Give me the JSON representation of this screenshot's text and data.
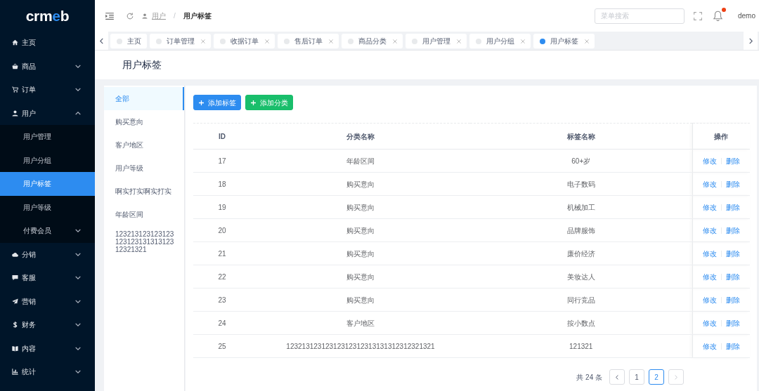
{
  "sidebar": {
    "logo": [
      {
        "text": "crm",
        "color": "#ffffff"
      },
      {
        "text": "e",
        "color": "#2d8cf0"
      },
      {
        "text": "b",
        "color": "#ffffff"
      }
    ],
    "items": [
      {
        "label": "主页",
        "kind": "link",
        "selected": false
      },
      {
        "label": "商品",
        "kind": "group",
        "selected": false,
        "expanded": false
      },
      {
        "label": "订单",
        "kind": "group",
        "selected": false,
        "expanded": false
      },
      {
        "label": "用户",
        "kind": "group",
        "selected": false,
        "expanded": true,
        "children": [
          {
            "label": "用户管理",
            "kind": "link",
            "selected": false
          },
          {
            "label": "用户分组",
            "kind": "link",
            "selected": false
          },
          {
            "label": "用户标签",
            "kind": "link",
            "selected": true
          },
          {
            "label": "用户等级",
            "kind": "link",
            "selected": false
          },
          {
            "label": "付费会员",
            "kind": "group",
            "selected": false,
            "expanded": false
          }
        ]
      },
      {
        "label": "分销",
        "kind": "group",
        "selected": false,
        "expanded": false
      },
      {
        "label": "客服",
        "kind": "group",
        "selected": false,
        "expanded": false
      },
      {
        "label": "营销",
        "kind": "group",
        "selected": false,
        "expanded": false
      },
      {
        "label": "财务",
        "kind": "group",
        "selected": false,
        "expanded": false
      },
      {
        "label": "内容",
        "kind": "group",
        "selected": false,
        "expanded": false
      },
      {
        "label": "统计",
        "kind": "group",
        "selected": false,
        "expanded": false
      }
    ]
  },
  "header": {
    "breadcrumb": {
      "items": [
        "用户",
        "用户标签"
      ],
      "separator": "/"
    },
    "search": {
      "placeholder": "菜单搜索"
    },
    "notifications": {
      "unread": true
    },
    "user": "demo"
  },
  "tabs": [
    {
      "label": "主页",
      "selected": false,
      "closable": false
    },
    {
      "label": "订单管理",
      "selected": false,
      "closable": true
    },
    {
      "label": "收据订单",
      "selected": false,
      "closable": true
    },
    {
      "label": "售后订单",
      "selected": false,
      "closable": true
    },
    {
      "label": "商品分类",
      "selected": false,
      "closable": true
    },
    {
      "label": "用户管理",
      "selected": false,
      "closable": true
    },
    {
      "label": "用户分组",
      "selected": false,
      "closable": true
    },
    {
      "label": "用户标签",
      "selected": true,
      "closable": true
    }
  ],
  "page_title": "用户标签",
  "category_list": [
    {
      "label": "全部",
      "selected": true
    },
    {
      "label": "购买意向",
      "selected": false
    },
    {
      "label": "客户地区",
      "selected": false
    },
    {
      "label": "用户等级",
      "selected": false
    },
    {
      "label": "啊实打实啊实打实",
      "selected": false
    },
    {
      "label": "年龄区间",
      "selected": false
    },
    {
      "label": "12321312312312312312313131312312321321",
      "selected": false
    }
  ],
  "buttons": [
    {
      "label": "添加标签",
      "kind": "primary"
    },
    {
      "label": "添加分类",
      "kind": "success"
    }
  ],
  "table": {
    "columns": [
      "ID",
      "分类名称",
      "标签名称",
      "操作"
    ],
    "rows": [
      {
        "id": "17",
        "category": "年龄区间",
        "tag": "60+岁",
        "actions": [
          "修改",
          "删除"
        ]
      },
      {
        "id": "18",
        "category": "购买意向",
        "tag": "电子数码",
        "actions": [
          "修改",
          "删除"
        ]
      },
      {
        "id": "19",
        "category": "购买意向",
        "tag": "机械加工",
        "actions": [
          "修改",
          "删除"
        ]
      },
      {
        "id": "20",
        "category": "购买意向",
        "tag": "品牌服饰",
        "actions": [
          "修改",
          "删除"
        ]
      },
      {
        "id": "21",
        "category": "购买意向",
        "tag": "廉价经济",
        "actions": [
          "修改",
          "删除"
        ]
      },
      {
        "id": "22",
        "category": "购买意向",
        "tag": "美妆达人",
        "actions": [
          "修改",
          "删除"
        ]
      },
      {
        "id": "23",
        "category": "购买意向",
        "tag": "同行竞品",
        "actions": [
          "修改",
          "删除"
        ]
      },
      {
        "id": "24",
        "category": "客户地区",
        "tag": "按小数点",
        "actions": [
          "修改",
          "删除"
        ]
      },
      {
        "id": "25",
        "category": "12321312312312312312313131312312321321",
        "tag": "121321",
        "actions": [
          "修改",
          "删除"
        ]
      }
    ]
  },
  "pagination": {
    "total": "共 24 条",
    "previous_disabled": false,
    "next_disabled": true,
    "pages": [
      {
        "label": "1",
        "selected": false
      },
      {
        "label": "2",
        "selected": true
      }
    ]
  }
}
